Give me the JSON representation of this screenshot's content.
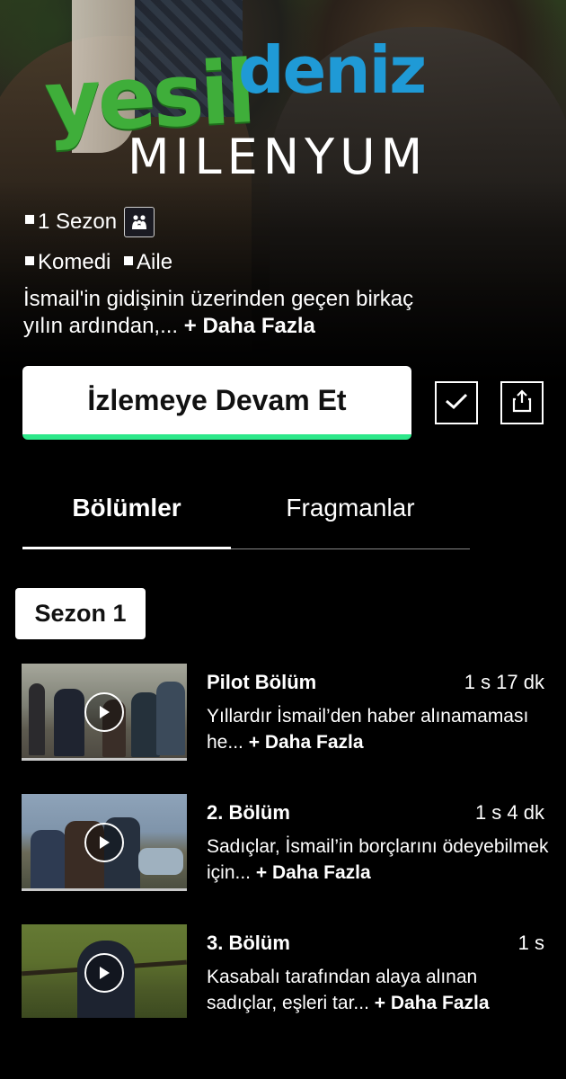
{
  "show": {
    "logo": {
      "line1": "yesil",
      "line2": "deniz",
      "line3": "MILENYUM"
    },
    "season_count": "1 Sezon",
    "rating_icon": "family-icon",
    "genres": [
      "Komedi",
      "Aile"
    ],
    "description": "İsmail'in gidişinin üzerinden geçen birkaç yılın ardından,...",
    "more_label": "+ Daha Fazla"
  },
  "actions": {
    "continue_label": "İzlemeye Devam Et",
    "watchlist_icon": "checkmark-icon",
    "share_icon": "share-icon",
    "accent_color": "#2de88a"
  },
  "tabs": [
    {
      "label": "Bölümler",
      "active": true
    },
    {
      "label": "Fragmanlar",
      "active": false
    }
  ],
  "season_selector": {
    "label": "Sezon 1"
  },
  "episodes": [
    {
      "title": "Pilot Bölüm",
      "duration": "1 s 17 dk",
      "description": "Yıllardır İsmail’den haber alınamaması he...",
      "more": "+ Daha Fazla"
    },
    {
      "title": "2. Bölüm",
      "duration": "1 s 4 dk",
      "description": "Sadıçlar, İsmail’in borçlarını ödeyebilmek için...",
      "more": "+ Daha Fazla"
    },
    {
      "title": "3. Bölüm",
      "duration": "1 s",
      "description": "Kasabalı tarafından alaya alınan sadıçlar, eşleri tar...",
      "more": "+ Daha Fazla"
    }
  ]
}
